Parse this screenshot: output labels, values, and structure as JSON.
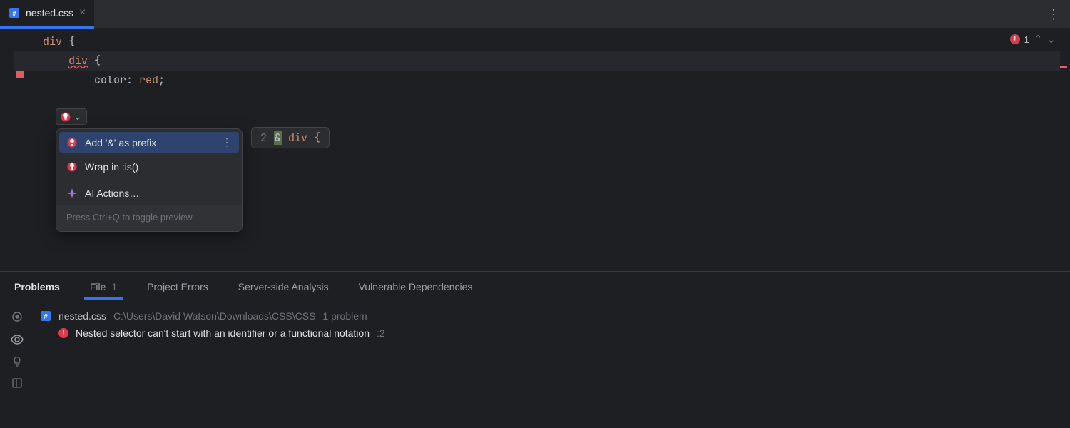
{
  "tab": {
    "filename": "nested.css"
  },
  "code": {
    "line1_sel": "div",
    "line1_brace": " {",
    "line2_indent": "    ",
    "line2_sel": "div",
    "line2_brace": " {",
    "line3_indent": "        ",
    "line3_prop": "color",
    "line3_colon": ": ",
    "line3_val": "red",
    "line3_semi": ";"
  },
  "errors": {
    "count": "1"
  },
  "popup": {
    "item1": "Add '&' as prefix",
    "item2": "Wrap in :is()",
    "item3": "AI Actions…",
    "hint": "Press Ctrl+Q to toggle preview"
  },
  "preview": {
    "line_no": "2",
    "amp": "&",
    "rest": " div {"
  },
  "panel": {
    "tab_problems": "Problems",
    "tab_file": "File",
    "tab_file_count": "1",
    "tab_project": "Project Errors",
    "tab_server": "Server-side Analysis",
    "tab_vuln": "Vulnerable Dependencies",
    "file_name": "nested.css",
    "file_path": "C:\\Users\\David Watson\\Downloads\\CSS\\CSS",
    "file_problems": "1 problem",
    "error_msg": "Nested selector can't start with an identifier or a functional notation",
    "error_pos": ":2"
  }
}
